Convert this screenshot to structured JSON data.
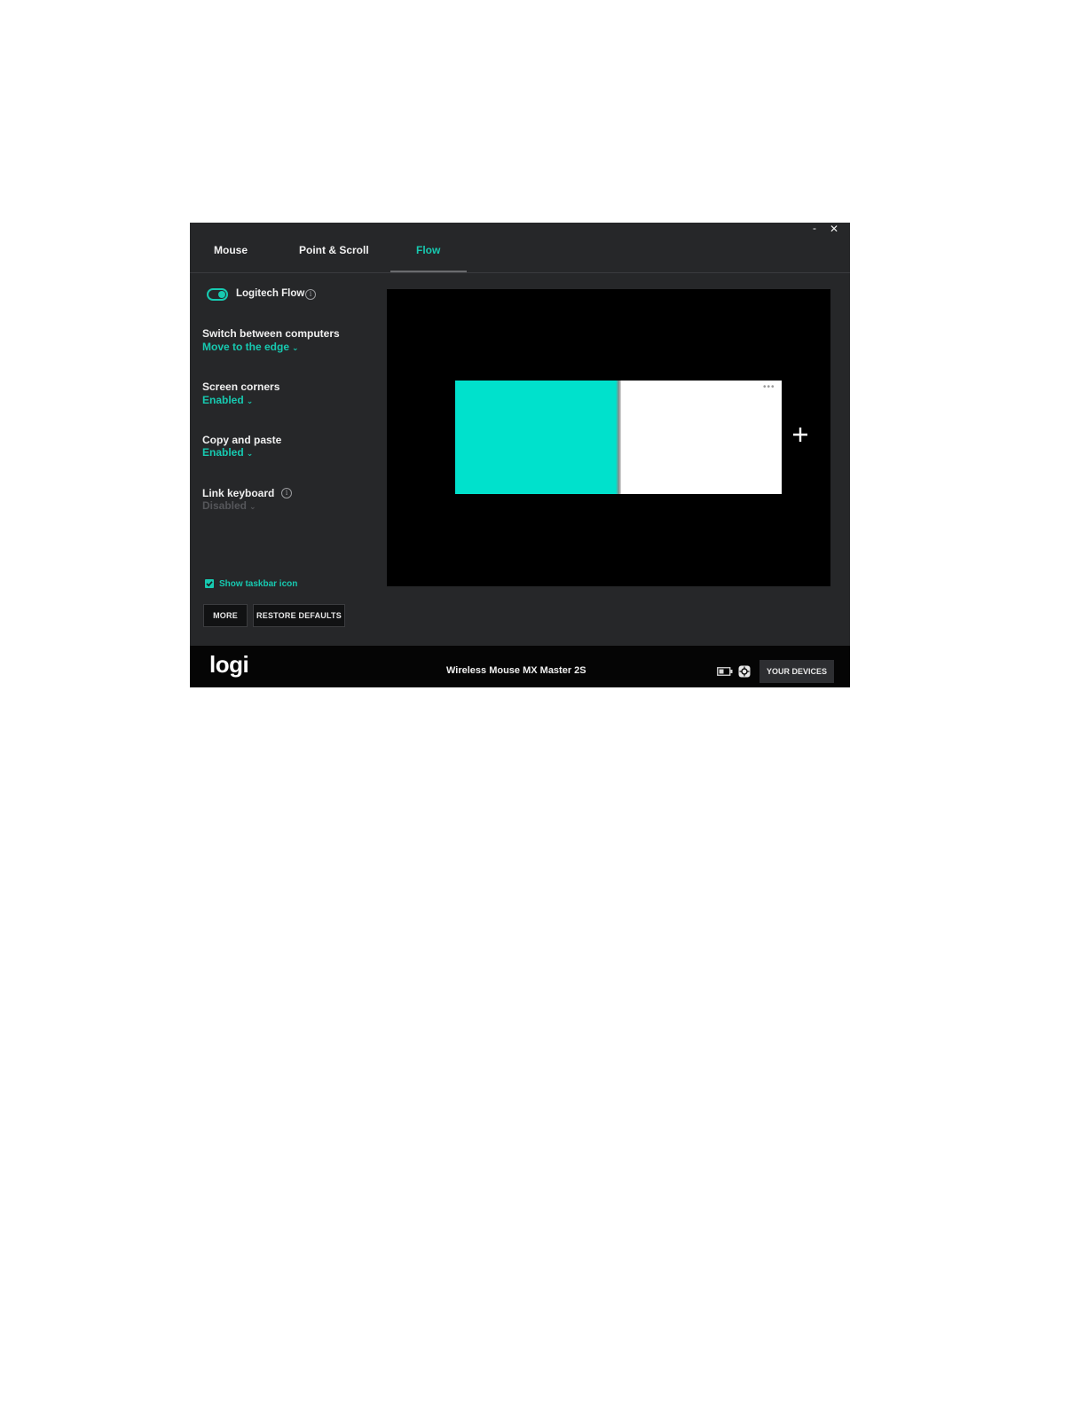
{
  "window": {
    "controls": {
      "minimize": "-",
      "close": "✕"
    }
  },
  "tabs": [
    {
      "label": "Mouse",
      "active": false
    },
    {
      "label": "Point & Scroll",
      "active": false
    },
    {
      "label": "Flow",
      "active": true
    }
  ],
  "flow": {
    "toggle_label": "Logitech Flow",
    "toggle_on": true,
    "info_glyph": "i",
    "settings": [
      {
        "title": "Switch between computers",
        "value": "Move to the edge",
        "enabled": true
      },
      {
        "title": "Screen corners",
        "value": "Enabled",
        "enabled": true
      },
      {
        "title": "Copy and paste",
        "value": "Enabled",
        "enabled": true
      },
      {
        "title": "Link keyboard",
        "value": "Disabled",
        "enabled": false
      }
    ],
    "chevron": "⌄",
    "taskbar_checkbox": {
      "label": "Show taskbar icon",
      "checked": true
    },
    "buttons": {
      "more": "MORE",
      "restore": "RESTORE DEFAULTS"
    }
  },
  "preview": {
    "screens": [
      {
        "color": "#00e1cc",
        "role": "this-computer"
      },
      {
        "color": "#ffffff",
        "role": "other-computer"
      }
    ],
    "more_dots": "•••"
  },
  "footer": {
    "logo": "logi",
    "device_name": "Wireless Mouse MX Master 2S",
    "devices_button": "YOUR DEVICES"
  },
  "colors": {
    "accent": "#17c9b0",
    "background": "#262729",
    "footer": "#050505"
  }
}
